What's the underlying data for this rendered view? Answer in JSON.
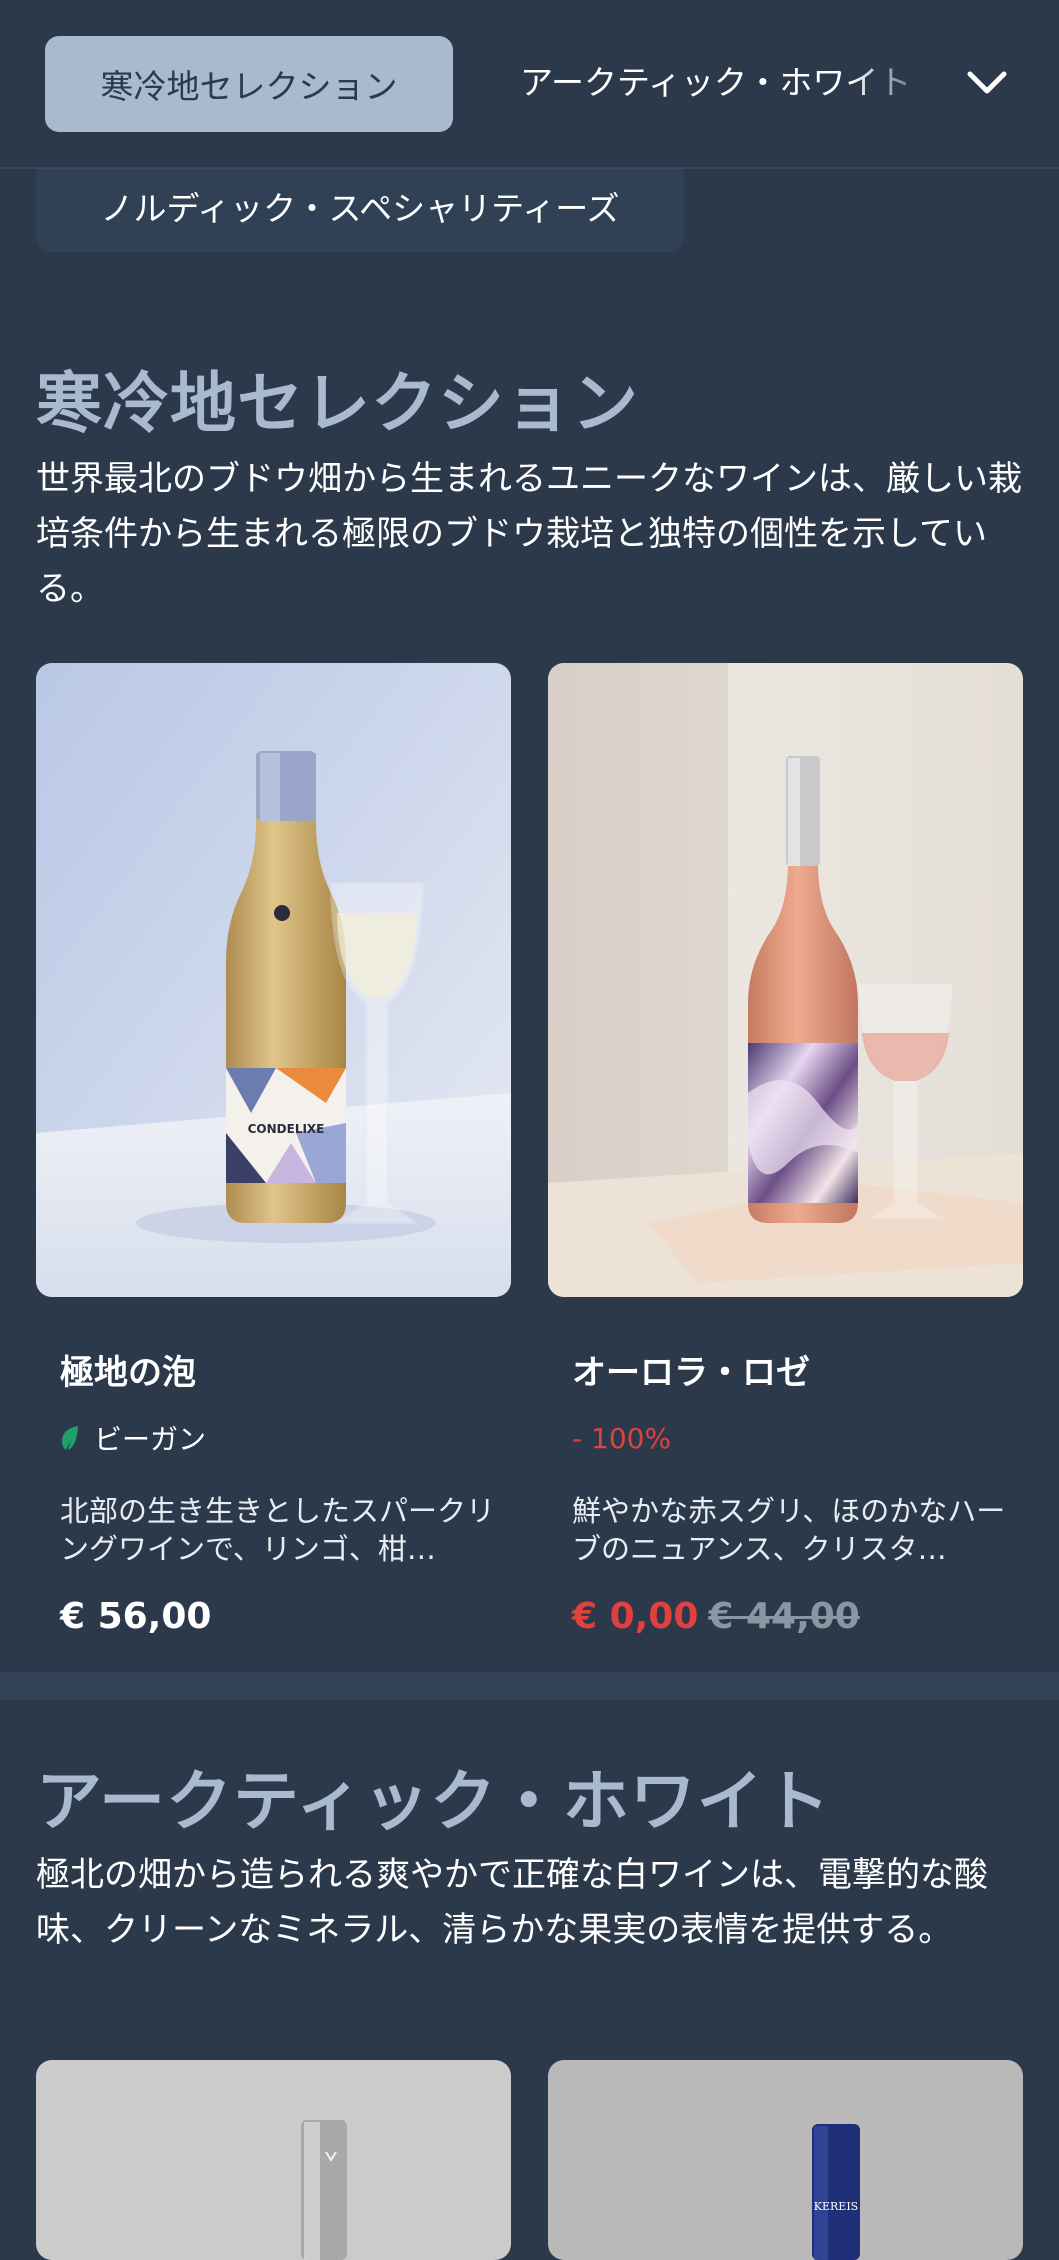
{
  "nav": {
    "active_tab": "寒冷地セレクション",
    "next_tab": "アークティック・ホワイト",
    "second_row_tab": "ノルディック・スペシャリティーズ",
    "expand_icon": "chevron-down-icon"
  },
  "sections": [
    {
      "title": "寒冷地セレクション",
      "description": "世界最北のブドウ畑から生まれるユニークなワインは、厳しい栽培条件から生まれる極限のブドウ栽培と独特の個性を示している。",
      "products": [
        {
          "name": "極地の泡",
          "tag": "ビーガン",
          "tag_icon": "leaf-icon",
          "description": "北部の生き生きとしたスパークリングワインで、リンゴ、柑…",
          "price": "€ 56,00",
          "image": "sparkling-wine-bottle-with-flute",
          "bottle_label": "CONDELIXE",
          "colors": {
            "bottle": "#cfae6c",
            "label_accent": "#e98b3a"
          }
        },
        {
          "name": "オーロラ・ロゼ",
          "tag": "- 100%",
          "description": "鮮やかな赤スグリ、ほのかなハーブのニュアンス、クリスタ…",
          "price": "€ 0,00",
          "old_price": "€ 44,00",
          "image": "rose-wine-bottle-with-glass",
          "colors": {
            "bottle": "#e09a7e",
            "accent_price": "#e0413e"
          }
        }
      ]
    },
    {
      "title": "アークティック・ホワイト",
      "description": "極北の畑から造られる爽やかで正確な白ワインは、電撃的な酸味、クリーンなミネラル、清らかな果実の表情を提供する。",
      "products": [
        {
          "image": "white-wine-bottle-silver-cap"
        },
        {
          "image": "white-wine-bottle-blue-cap",
          "bottle_label": "KEREIS"
        }
      ]
    }
  ],
  "colors": {
    "background": "#2b394b",
    "tab_active": "#a9b9d0",
    "vegan_green": "#1fa06a",
    "discount_red": "#e0413e"
  }
}
